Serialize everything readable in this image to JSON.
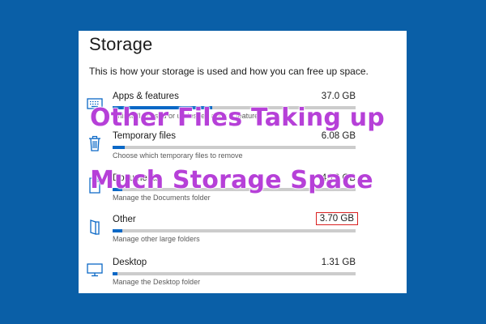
{
  "page": {
    "title": "Storage",
    "intro": "This is how your storage is used and how you can free up space."
  },
  "items": [
    {
      "name": "Apps & features",
      "size": "37.0 GB",
      "desc": "Uninstall unused or undesired apps & features",
      "fill": 0.41,
      "icon": "keyboard-icon"
    },
    {
      "name": "Temporary files",
      "size": "6.08 GB",
      "desc": "Choose which temporary files to remove",
      "fill": 0.05,
      "icon": "trash-icon"
    },
    {
      "name": "Documents",
      "size": "4.76 GB",
      "desc": "Manage the Documents folder",
      "fill": 0.04,
      "icon": "document-icon"
    },
    {
      "name": "Other",
      "size": "3.70 GB",
      "desc": "Manage other large folders",
      "fill": 0.04,
      "icon": "folder-icon"
    },
    {
      "name": "Desktop",
      "size": "1.31 GB",
      "desc": "Manage the Desktop folder",
      "fill": 0.02,
      "icon": "monitor-icon"
    }
  ],
  "overlay": {
    "line1": "Other Files Taking up",
    "line2": "Much Storage Space"
  },
  "colors": {
    "background": "#0a5fa7",
    "accent": "#0a68c6",
    "overlay_text": "#b640d8",
    "highlight_border": "#d92020"
  }
}
